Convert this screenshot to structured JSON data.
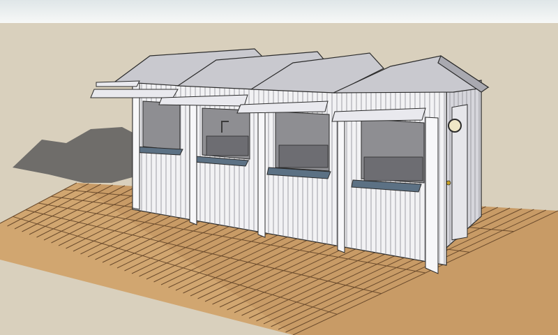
{
  "scene": {
    "subject": "four-bay-beach-hut-kiosk-on-wooden-deck",
    "colors": {
      "sky_top": "#dfe6e8",
      "sky_bottom": "#f7f8f7",
      "ground": "#d9d0bd",
      "shadow": "#5c5c5c",
      "deck_a": "#c89b66",
      "deck_b": "#d6ab75",
      "deck_line": "#6b4b2c",
      "wall": "#f2f2f4",
      "wall_side": "#d6d6dc",
      "plank_line": "#8a8a92",
      "roof": "#c9c9cf",
      "roof_dark": "#a9a9b0",
      "counter": "#5c7184",
      "interior": "#8e8e92",
      "interior_dark": "#6d6d72",
      "outline": "#2b2b2b",
      "hardware": "#c9a227"
    }
  }
}
